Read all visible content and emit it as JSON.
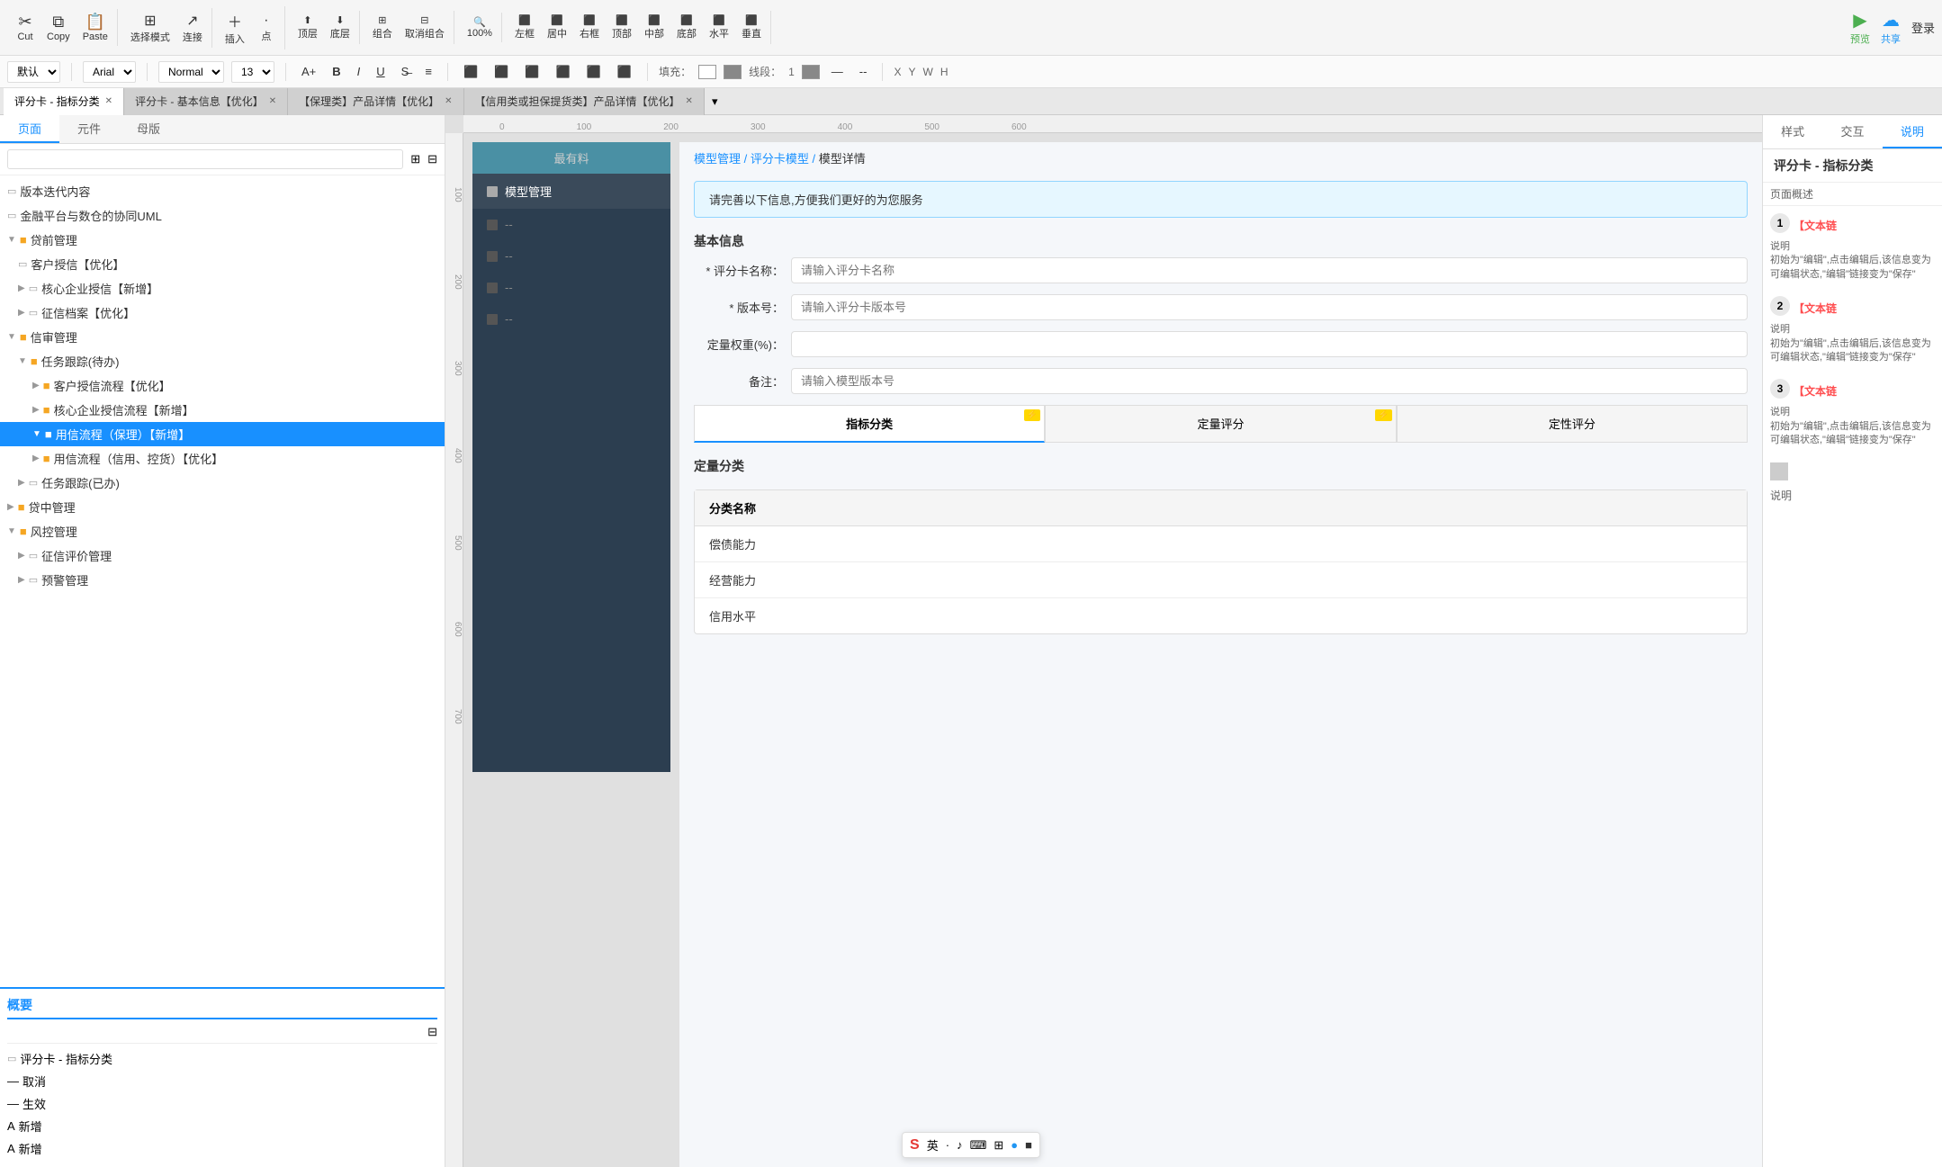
{
  "toolbar": {
    "cut_label": "Cut",
    "copy_label": "Copy",
    "paste_label": "Paste",
    "select_mode_label": "选择模式",
    "connect_label": "连接",
    "insert_label": "插入",
    "point_label": "点",
    "top_label": "顶层",
    "bottom_label": "底层",
    "left_label": "左框",
    "center_h_label": "居中",
    "right_label": "右框",
    "top2_label": "顶部",
    "center_v_label": "中部",
    "bottom2_label": "底部",
    "h_label": "水平",
    "v_label": "垂直",
    "preview_label": "预览",
    "share_label": "共享",
    "login_label": "登录",
    "group_label": "组合",
    "ungroup_label": "取消组合",
    "zoom_label": "100%"
  },
  "format_bar": {
    "font_family": "Arial",
    "font_style": "Normal",
    "font_size": "13",
    "fill_label": "填充：",
    "stroke_label": "线段：",
    "x_label": "X",
    "y_label": "Y",
    "w_label": "W",
    "h_label": "H",
    "default_font": "默认"
  },
  "tabs": [
    {
      "label": "评分卡 - 指标分类",
      "active": true,
      "closable": true
    },
    {
      "label": "评分卡 - 基本信息【优化】",
      "active": false,
      "closable": true
    },
    {
      "label": "【保理类】产品详情【优化】",
      "active": false,
      "closable": true
    },
    {
      "label": "【信用类或担保提货类】产品详情【优化】",
      "active": false,
      "closable": true
    }
  ],
  "left_panel": {
    "tabs": [
      "页面",
      "元件",
      "母版"
    ],
    "active_tab": "页面",
    "search_placeholder": "",
    "tree": [
      {
        "label": "版本迭代内容",
        "level": 0,
        "type": "page",
        "indent": 0
      },
      {
        "label": "金融平台与数仓的协同UML",
        "level": 0,
        "type": "page",
        "indent": 0
      },
      {
        "label": "贷前管理",
        "level": 0,
        "type": "folder",
        "expanded": true,
        "indent": 0
      },
      {
        "label": "客户授信【优化】",
        "level": 1,
        "type": "page",
        "indent": 1
      },
      {
        "label": "核心企业授信【新增】",
        "level": 1,
        "type": "page",
        "indent": 1,
        "expandable": true
      },
      {
        "label": "征信档案【优化】",
        "level": 1,
        "type": "page",
        "indent": 1,
        "expandable": true
      },
      {
        "label": "信审管理",
        "level": 0,
        "type": "folder",
        "expanded": true,
        "indent": 0
      },
      {
        "label": "任务跟踪(待办)",
        "level": 1,
        "type": "folder",
        "expanded": true,
        "indent": 1
      },
      {
        "label": "客户授信流程【优化】",
        "level": 2,
        "type": "folder",
        "indent": 2,
        "expandable": true
      },
      {
        "label": "核心企业授信流程【新增】",
        "level": 2,
        "type": "folder",
        "indent": 2,
        "expandable": true
      },
      {
        "label": "用信流程（保理）【新增】",
        "level": 2,
        "type": "folder",
        "indent": 2,
        "active": true
      },
      {
        "label": "用信流程（信用、控货）【优化】",
        "level": 2,
        "type": "folder",
        "indent": 2,
        "expandable": true
      },
      {
        "label": "任务跟踪(已办)",
        "level": 1,
        "type": "page",
        "indent": 1,
        "expandable": true
      },
      {
        "label": "贷中管理",
        "level": 0,
        "type": "folder",
        "expanded": false,
        "indent": 0
      },
      {
        "label": "风控管理",
        "level": 0,
        "type": "folder",
        "expanded": true,
        "indent": 0
      },
      {
        "label": "征信评价管理",
        "level": 1,
        "type": "page",
        "indent": 1,
        "expandable": true
      },
      {
        "label": "预警管理",
        "level": 1,
        "type": "page",
        "indent": 1,
        "expandable": true
      }
    ]
  },
  "overview": {
    "title": "概要",
    "search_placeholder": "",
    "root_item": "评分卡 - 指标分类",
    "items": [
      {
        "label": "取消",
        "icon": "minus"
      },
      {
        "label": "生效",
        "icon": "minus"
      },
      {
        "label": "新增",
        "icon": "text"
      },
      {
        "label": "新增",
        "icon": "text"
      }
    ]
  },
  "canvas": {
    "zoom": "100%",
    "ruler_marks_h": [
      "0",
      "100",
      "200",
      "300",
      "400",
      "500",
      "600"
    ],
    "ruler_marks_v": [
      "100",
      "200",
      "300",
      "400",
      "500",
      "600",
      "700"
    ],
    "design_frame": {
      "header": "最有料",
      "nav_items": [
        {
          "label": "模型管理",
          "active": true
        },
        {
          "label": "--",
          "active": false
        },
        {
          "label": "--",
          "active": false
        },
        {
          "label": "--",
          "active": false
        },
        {
          "label": "--",
          "active": false
        }
      ]
    },
    "content": {
      "breadcrumb": [
        "模型管理",
        "评分卡模型",
        "模型详情"
      ],
      "alert": "请完善以下信息,方便我们更好的为您服务",
      "section_title": "基本信息",
      "form_fields": [
        {
          "label": "评分卡名称：",
          "placeholder": "请输入评分卡名称",
          "required": true
        },
        {
          "label": "版本号：",
          "placeholder": "请输入评分卡版本号",
          "required": true
        },
        {
          "label": "定量权重(%)：",
          "placeholder": "",
          "required": false
        },
        {
          "label": "备注：",
          "placeholder": "请输入模型版本号",
          "required": false
        }
      ],
      "tab_buttons": [
        {
          "label": "指标分类",
          "active": true,
          "badge": "⚡"
        },
        {
          "label": "定量评分",
          "active": false,
          "badge": "⚡"
        },
        {
          "label": "定性评分",
          "active": false
        }
      ],
      "quantitative_section": "定量分类",
      "table_header": "分类名称",
      "table_rows": [
        "偿债能力",
        "经营能力",
        "信用水平"
      ]
    }
  },
  "right_panel": {
    "tabs": [
      "样式",
      "交互",
      "说明"
    ],
    "active_tab": "说明",
    "title": "评分卡 - 指标分类",
    "page_overview_label": "页面概述",
    "numbered_items": [
      {
        "number": "1",
        "tag": "【文本链",
        "description": "说明\n初始为\"编辑\",点击编辑后,该信息变为可编辑状态,\"编辑\"链接变为\"保存\""
      },
      {
        "number": "2",
        "tag": "【文本链",
        "description": "说明\n初始为\"编辑\",点击编辑后,该信息变为可编辑状态,\"编辑\"链接变为\"保存\""
      },
      {
        "number": "3",
        "tag": "【文本链",
        "description": "说明\n初始为\"编辑\",点击编辑后,该信息变为可编辑状态,\"编辑\"链接变为\"保存\""
      }
    ],
    "description_label": "说明"
  },
  "ime": {
    "logo": "S",
    "options": [
      "英",
      "·",
      "♪",
      "⌨",
      "⊞",
      "🔵",
      "⬛"
    ]
  }
}
